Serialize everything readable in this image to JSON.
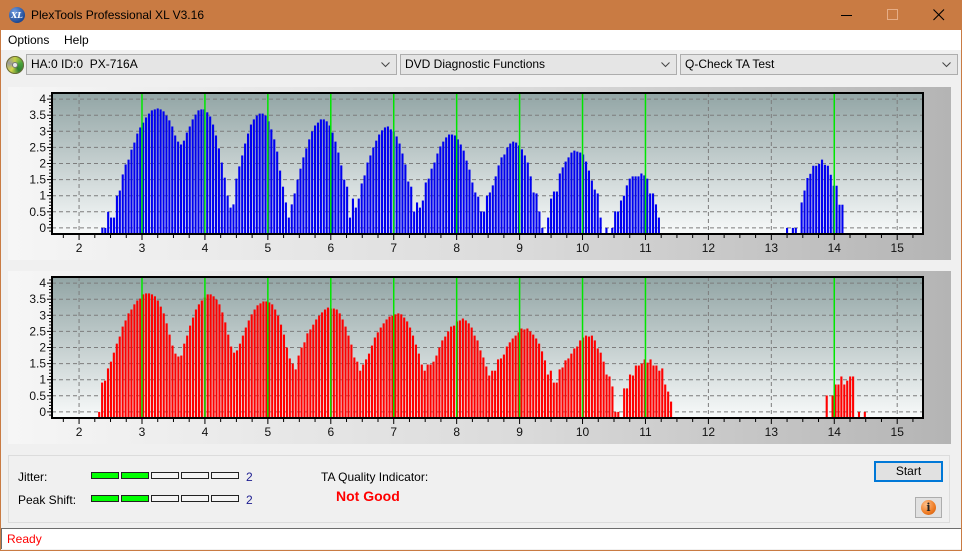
{
  "window": {
    "title": "PlexTools Professional XL V3.16",
    "app_icon": "xl-logo-icon",
    "app_icon_text": "XL",
    "controls": {
      "minimize": "minimize-icon",
      "maximize": "maximize-icon",
      "close": "close-icon"
    }
  },
  "menu": [
    {
      "label": "Options"
    },
    {
      "label": "Help"
    }
  ],
  "toolbar": {
    "drive_icon": "disc-icon",
    "drive_select": {
      "value": "HA:0 ID:0  PX-716A"
    },
    "function_select": {
      "value": "DVD Diagnostic Functions"
    },
    "test_select": {
      "value": "Q-Check TA Test"
    }
  },
  "results": {
    "jitter": {
      "label": "Jitter:",
      "value": "2",
      "level": 2,
      "max_level": 5
    },
    "peak_shift": {
      "label": "Peak Shift:",
      "value": "2",
      "level": 2,
      "max_level": 5
    },
    "ta_quality": {
      "label": "TA Quality Indicator:",
      "value": "Not Good"
    },
    "start_label": "Start",
    "info_icon": "info-icon",
    "info_glyph": "i"
  },
  "status": {
    "text": "Ready"
  },
  "colors": {
    "title_bar": "#C97B43",
    "reference_line": "#00E600",
    "level_on": "#00FF00",
    "level_value": "#1C1C90",
    "not_good": "#FF0000",
    "status_text": "#FF0000"
  },
  "chart_data": [
    {
      "type": "bar",
      "title": "",
      "xlabel": "",
      "ylabel": "",
      "xlim": [
        1.57,
        15.41
      ],
      "ylim": [
        -0.19,
        4.19
      ],
      "grid": true,
      "x_ticks": [
        2,
        3,
        4,
        5,
        6,
        7,
        8,
        9,
        10,
        11,
        12,
        13,
        14,
        15
      ],
      "y_ticks": [
        4,
        3.5,
        3,
        2.5,
        2,
        1.5,
        1,
        0.5,
        0
      ],
      "reference_lines_x": [
        3,
        4,
        5,
        6,
        7,
        8,
        9,
        10,
        11,
        14
      ],
      "series": [
        {
          "color": "#0000F0",
          "x_step": 0.0463,
          "segments": [
            {
              "x_start": 2.37,
              "values": [
                0,
                0,
                0.5,
                0.32,
                0.32,
                1.0,
                1.16,
                1.66,
                1.97,
                2.12,
                2.43,
                2.65,
                2.93,
                3.12,
                3.27,
                3.43,
                3.55,
                3.65,
                3.68,
                3.71,
                3.68,
                3.62,
                3.49,
                3.34,
                3.15,
                2.87,
                2.68,
                2.59,
                2.71,
                2.96,
                3.15,
                3.37,
                3.52,
                3.65,
                3.68,
                3.68,
                3.59,
                3.46,
                3.21,
                2.87,
                2.47,
                2.03,
                1.56,
                1.0,
                0.63,
                0.73,
                1.53,
                1.91,
                2.25,
                2.62,
                2.93,
                3.21,
                3.37,
                3.49,
                3.55,
                3.55,
                3.49,
                3.31,
                3.06,
                2.75,
                2.37,
                1.78,
                1.28,
                0.79,
                0.32,
                0.73,
                1.07,
                1.5,
                1.84,
                2.19,
                2.47,
                2.75,
                3.0,
                3.18,
                3.27,
                3.37,
                3.37,
                3.31,
                3.18,
                2.96,
                2.68,
                2.34,
                1.94,
                1.5,
                1.28,
                0.32,
                0.91,
                0.63,
                0.91,
                1.38,
                1.63,
                2.03,
                2.25,
                2.5,
                2.71,
                2.9,
                3.03,
                3.12,
                3.15,
                3.06,
                3.0,
                2.84,
                2.62,
                2.31,
                1.97,
                1.44,
                1.28,
                0.51,
                0.79,
                0.63,
                0.85,
                1.41,
                1.53,
                1.84,
                2.03,
                2.31,
                2.53,
                2.68,
                2.81,
                2.9,
                2.9,
                2.87,
                2.75,
                2.59,
                2.4,
                2.09,
                1.81,
                1.41,
                1.1,
                0.97,
                0.51,
                0.51,
                1.0,
                1.1,
                1.32,
                1.6,
                1.94,
                2.19,
                2.28,
                2.5,
                2.62,
                2.68,
                2.65,
                2.56,
                2.44,
                2.25,
                2.03,
                1.6,
                1.1,
                1.07,
                0.51,
                0,
                null,
                0.32,
                0.91,
                1.13,
                1.13,
                1.69,
                1.88,
                2.06,
                2.19,
                2.34,
                2.4,
                2.37,
                2.34,
                2.28,
                2.06,
                1.78,
                1.47,
                1.19,
                1.07,
                0.32,
                null,
                0,
                null,
                0,
                0.51,
                0.51,
                0.85,
                1.0,
                1.32,
                1.53,
                1.6,
                1.6,
                1.6,
                1.69,
                1.63,
                1.53,
                1.07,
                1.07,
                0.73,
                0.32
              ]
            },
            {
              "x_start": 13.25,
              "values": [
                0,
                null,
                0,
                0,
                null,
                0.79,
                1.16,
                1.55,
                1.68,
                1.93,
                1.93,
                1.99,
                2.12,
                1.96,
                1.93,
                1.65,
                1.31,
                1.31,
                0.72,
                0.72
              ]
            }
          ]
        }
      ]
    },
    {
      "type": "bar",
      "title": "",
      "xlabel": "",
      "ylabel": "",
      "xlim": [
        1.57,
        15.41
      ],
      "ylim": [
        -0.19,
        4.19
      ],
      "grid": true,
      "x_ticks": [
        2,
        3,
        4,
        5,
        6,
        7,
        8,
        9,
        10,
        11,
        12,
        13,
        14,
        15
      ],
      "y_ticks": [
        4,
        3.5,
        3,
        2.5,
        2,
        1.5,
        1,
        0.5,
        0
      ],
      "reference_lines_x": [
        3,
        4,
        5,
        6,
        7,
        8,
        9,
        10,
        11,
        14
      ],
      "series": [
        {
          "color": "#FF0000",
          "x_step": 0.0466,
          "segments": [
            {
              "x_start": 2.32,
              "values": [
                0,
                0.91,
                0.97,
                1.35,
                1.56,
                1.84,
                2.12,
                2.34,
                2.65,
                2.84,
                3.06,
                3.18,
                3.34,
                3.46,
                3.52,
                3.65,
                3.68,
                3.68,
                3.65,
                3.59,
                3.46,
                3.27,
                3.06,
                2.75,
                2.4,
                2.06,
                1.81,
                1.72,
                1.75,
                2.12,
                2.37,
                2.68,
                2.93,
                3.18,
                3.34,
                3.46,
                3.55,
                3.65,
                3.65,
                3.59,
                3.49,
                3.34,
                3.09,
                2.78,
                2.4,
                2.03,
                1.84,
                1.91,
                2.12,
                2.37,
                2.62,
                2.84,
                3.03,
                3.18,
                3.31,
                3.37,
                3.43,
                3.43,
                3.4,
                3.34,
                3.18,
                2.99,
                2.71,
                2.4,
                2.0,
                1.66,
                1.5,
                1.32,
                1.75,
                2.0,
                2.16,
                2.44,
                2.56,
                2.71,
                2.87,
                2.99,
                3.09,
                3.18,
                3.24,
                3.21,
                3.21,
                3.18,
                3.06,
                2.87,
                2.65,
                2.37,
                2.09,
                1.69,
                1.56,
                1.28,
                1.47,
                1.63,
                1.81,
                2.06,
                2.31,
                2.47,
                2.62,
                2.75,
                2.87,
                2.96,
                2.99,
                3.03,
                3.06,
                3.03,
                2.93,
                2.81,
                2.62,
                2.37,
                2.09,
                1.81,
                1.47,
                1.28,
                1.47,
                1.47,
                1.56,
                1.75,
                2.0,
                2.22,
                2.34,
                2.5,
                2.65,
                2.68,
                2.81,
                2.84,
                2.9,
                2.84,
                2.75,
                2.62,
                2.37,
                2.22,
                1.91,
                1.69,
                1.41,
                1.13,
                1.28,
                1.28,
                1.63,
                1.66,
                1.78,
                2.03,
                2.16,
                2.28,
                2.37,
                2.47,
                2.59,
                2.56,
                2.59,
                2.5,
                2.4,
                2.28,
                2.12,
                1.88,
                1.6,
                1.16,
                1.28,
                0.91,
                0.91,
                1.32,
                1.38,
                1.6,
                1.66,
                1.81,
                1.97,
                2.03,
                2.22,
                2.31,
                2.37,
                2.34,
                2.37,
                2.22,
                1.97,
                1.84,
                1.56,
                1.16,
                1.1,
                0.79,
                0,
                0,
                null,
                0.73,
                0.73,
                1.16,
                1.13,
                1.44,
                1.44,
                1.5,
                1.63,
                1.53,
                1.63,
                1.44,
                1.44,
                1.28,
                1.35,
                0.85,
                0.63,
                0.32
              ]
            },
            {
              "x_start": 13.88,
              "values": [
                0.51,
                null,
                0.51,
                0.85,
                0.85,
                1.1,
                0.85,
                0.97,
                1.1,
                1.1,
                null,
                0,
                null,
                0
              ]
            }
          ]
        }
      ]
    }
  ]
}
